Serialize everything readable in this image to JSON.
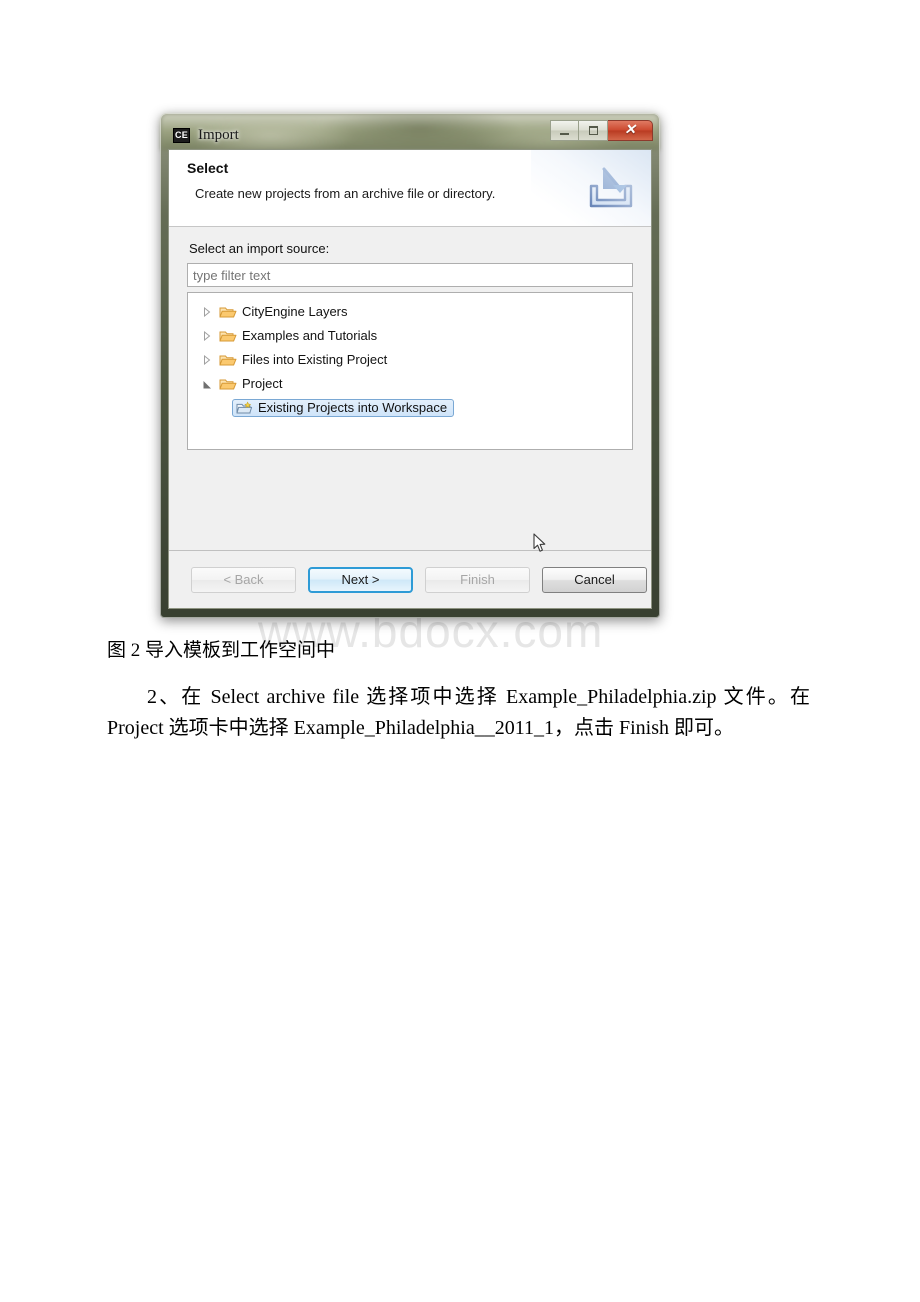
{
  "document": {
    "watermark": "www.bdocx.com",
    "figure_caption": "图 2 导入模板到工作空间中",
    "paragraph": "2、在 Select archive file 选择项中选择 Example_Philadelphia.zip 文件。在 Project 选项卡中选择 Example_Philadelphia__2011_1，点击 Finish 即可。"
  },
  "dialog": {
    "app_icon_label": "CE",
    "title": "Import",
    "window_controls": {
      "minimize": "minimize-icon",
      "maximize": "maximize-icon",
      "close": "✕"
    },
    "header": {
      "title": "Select",
      "description": "Create new projects from an archive file or directory.",
      "icon": "import-tray-icon"
    },
    "body": {
      "source_label": "Select an import source:",
      "filter": {
        "value": "",
        "placeholder": "type filter text"
      },
      "tree": [
        {
          "label": "CityEngine Layers",
          "icon": "folder-icon",
          "expanded": false,
          "level": 0,
          "selected": false
        },
        {
          "label": "Examples and Tutorials",
          "icon": "folder-icon",
          "expanded": false,
          "level": 0,
          "selected": false
        },
        {
          "label": "Files into Existing Project",
          "icon": "folder-icon",
          "expanded": false,
          "level": 0,
          "selected": false
        },
        {
          "label": "Project",
          "icon": "folder-icon",
          "expanded": true,
          "level": 0,
          "selected": false
        },
        {
          "label": "Existing Projects into Workspace",
          "icon": "project-import-icon",
          "expanded": null,
          "level": 1,
          "selected": true
        }
      ]
    },
    "buttons": {
      "back": "< Back",
      "next": "Next >",
      "finish": "Finish",
      "cancel": "Cancel"
    },
    "colors": {
      "accent_blue": "#2e9bd6",
      "selection_blue": "#cfe4f9",
      "close_red": "#cc4a30",
      "folder_amber": "#f5c368"
    }
  }
}
